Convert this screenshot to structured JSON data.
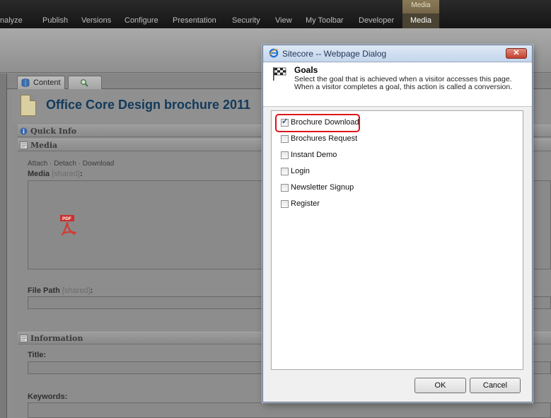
{
  "ribbon": {
    "tabs": [
      {
        "label": "nalyze"
      },
      {
        "label": "Publish"
      },
      {
        "label": "Versions"
      },
      {
        "label": "Configure"
      },
      {
        "label": "Presentation"
      },
      {
        "label": "Security"
      },
      {
        "label": "View"
      },
      {
        "label": "My Toolbar"
      },
      {
        "label": "Developer"
      }
    ],
    "context_group_label": "Media",
    "context_tab_label": "Media"
  },
  "editor_tabs": {
    "content_label": "Content"
  },
  "item": {
    "title": "Office Core Design brochure 2011"
  },
  "sections": {
    "quick_info": "Quick Info",
    "media": "Media",
    "information": "Information"
  },
  "media_section": {
    "links": "Attach · Detach · Download",
    "media_label": "Media",
    "shared_tag": "[shared]",
    "colon": ":",
    "file_path_label": "File Path",
    "pdf_text": "PDF"
  },
  "information_section": {
    "title_label": "Title:",
    "keywords_label": "Keywords:"
  },
  "dialog": {
    "title": "Sitecore -- Webpage Dialog",
    "close_glyph": "✕",
    "heading": "Goals",
    "description": "Select the goal that is achieved when a visitor accesses this page. When a visitor completes a goal, this action is called a conversion.",
    "goals": [
      {
        "label": "Brochure Download",
        "checked": true
      },
      {
        "label": "Brochures Request",
        "checked": false
      },
      {
        "label": "Instant Demo",
        "checked": false
      },
      {
        "label": "Login",
        "checked": false
      },
      {
        "label": "Newsletter Signup",
        "checked": false
      },
      {
        "label": "Register",
        "checked": false
      }
    ],
    "ok_label": "OK",
    "cancel_label": "Cancel"
  },
  "colors": {
    "highlight": "#e0131b",
    "title_blue": "#123a5c",
    "dialog_bg": "#f0f0f0"
  }
}
